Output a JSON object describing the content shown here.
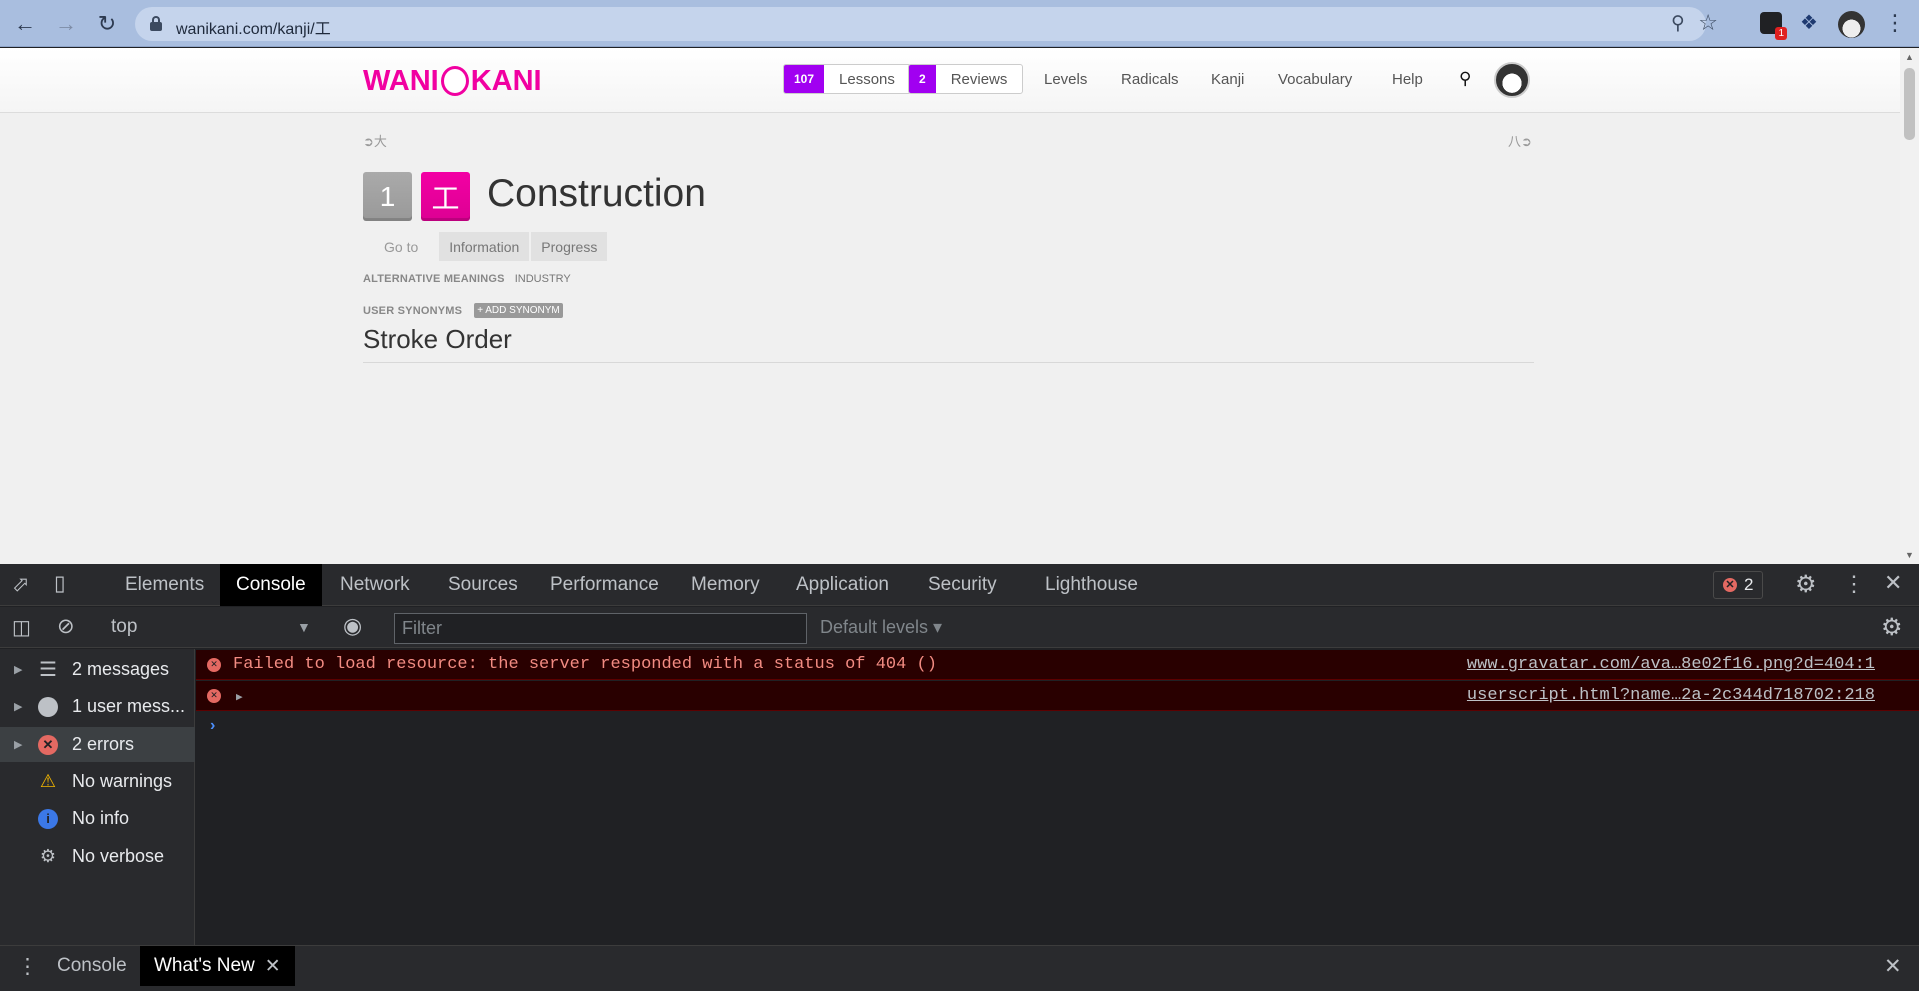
{
  "browser": {
    "url": "wanikani.com/kanji/工",
    "extension_badge": "1"
  },
  "header": {
    "logo_left": "WANI",
    "logo_right": "KANI",
    "lessons_count": "107",
    "lessons_label": "Lessons",
    "reviews_count": "2",
    "reviews_label": "Reviews",
    "nav": [
      "Levels",
      "Radicals",
      "Kanji",
      "Vocabulary",
      "Help"
    ]
  },
  "kanji": {
    "prev_nav": "大",
    "next_nav": "八",
    "level": "1",
    "character": "工",
    "meaning": "Construction",
    "goto_label": "Go to",
    "goto_buttons": [
      "Information",
      "Progress"
    ],
    "alt_meanings_label": "ALTERNATIVE MEANINGS",
    "alt_meanings_value": "INDUSTRY",
    "user_synonyms_label": "USER SYNONYMS",
    "add_synonym_label": "+ ADD SYNONYM",
    "section_title": "Stroke Order"
  },
  "devtools": {
    "tabs": [
      "Elements",
      "Console",
      "Network",
      "Sources",
      "Performance",
      "Memory",
      "Application",
      "Security",
      "Lighthouse"
    ],
    "error_count": "2",
    "context": "top",
    "filter_placeholder": "Filter",
    "levels_label": "Default levels ▾",
    "sidebar": {
      "messages": "2 messages",
      "user_messages": "1 user mess...",
      "errors": "2 errors",
      "warnings": "No warnings",
      "info": "No info",
      "verbose": "No verbose"
    },
    "messages": [
      {
        "text": "Failed to load resource: the server responded with a status of 404 ()",
        "source": "www.gravatar.com/ava…8e02f16.png?d=404:1"
      },
      {
        "text": "",
        "source": "userscript.html?name…2a-2c344d718702:218"
      }
    ],
    "drawer_tabs": [
      "Console",
      "What's New"
    ]
  }
}
